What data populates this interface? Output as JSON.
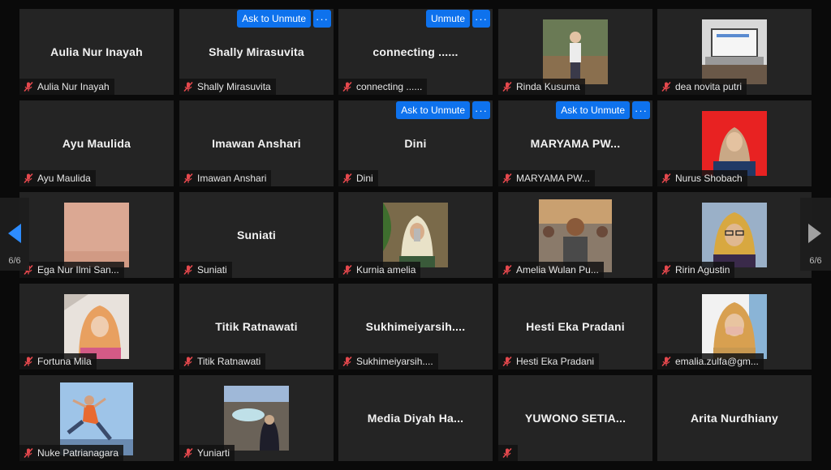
{
  "pager": {
    "left_label": "6/6",
    "right_label": "6/6"
  },
  "colors": {
    "tile_bg": "#242424",
    "accent": "#0e72ed",
    "mute": "#e5484d"
  },
  "tiles": [
    {
      "name": "Aulia Nur Inayah",
      "center": "Aulia Nur Inayah",
      "video": false
    },
    {
      "name": "Shally Mirasuvita",
      "center": "Shally Mirasuvita",
      "video": false,
      "action": "Ask to Unmute"
    },
    {
      "name": "connecting ......",
      "center": "connecting ......",
      "video": false,
      "action": "Unmute"
    },
    {
      "name": "Rinda Kusuma",
      "video": true,
      "photo": "person-outdoors"
    },
    {
      "name": "dea novita putri",
      "video": true,
      "photo": "laptop-screen"
    },
    {
      "name": "Ayu Maulida",
      "center": "Ayu Maulida",
      "video": false
    },
    {
      "name": "Imawan Anshari",
      "center": "Imawan Anshari",
      "video": false
    },
    {
      "name": "Dini",
      "center": "Dini",
      "video": false,
      "action": "Ask to Unmute"
    },
    {
      "name": "MARYAMA PW...",
      "center": "MARYAMA PW...",
      "video": false,
      "action": "Ask to Unmute"
    },
    {
      "name": "Nurus Shobach",
      "video": true,
      "photo": "hijab-red-bg"
    },
    {
      "name": "Ega Nur Ilmi San...",
      "video": true,
      "photo": "skin-tone"
    },
    {
      "name": "Suniati",
      "center": "Suniati",
      "video": false
    },
    {
      "name": "Kurnia amelia",
      "video": true,
      "photo": "hijab-selfie"
    },
    {
      "name": "Amelia Wulan Pu...",
      "video": true,
      "photo": "crowd-photo"
    },
    {
      "name": "Ririn Agustin",
      "video": true,
      "photo": "hijab-glasses"
    },
    {
      "name": "Fortuna Mila",
      "video": true,
      "photo": "car-selfie"
    },
    {
      "name": "Titik Ratnawati",
      "center": "Titik Ratnawati",
      "video": false
    },
    {
      "name": "Sukhimeiyarsih....",
      "center": "Sukhimeiyarsih....",
      "video": false
    },
    {
      "name": "Hesti Eka Pradani",
      "center": "Hesti Eka Pradani",
      "video": false
    },
    {
      "name": "emalia.zulfa@gm...",
      "video": true,
      "photo": "hijab-mask"
    },
    {
      "name": "Nuke Patrianagara",
      "video": true,
      "photo": "jumping-sky"
    },
    {
      "name": "Yuniarti",
      "video": true,
      "photo": "crater-lake"
    },
    {
      "name": "Media Diyah Ha...",
      "center": "Media  Diyah  Ha...",
      "video": false,
      "nolabel": true
    },
    {
      "name": "YUWONO SETIA...",
      "center": "YUWONO  SETIA...",
      "video": false,
      "mute_only": true
    },
    {
      "name": "Arita Nurdhiany",
      "center": "Arita Nurdhiany",
      "video": false,
      "nolabel": true
    }
  ]
}
